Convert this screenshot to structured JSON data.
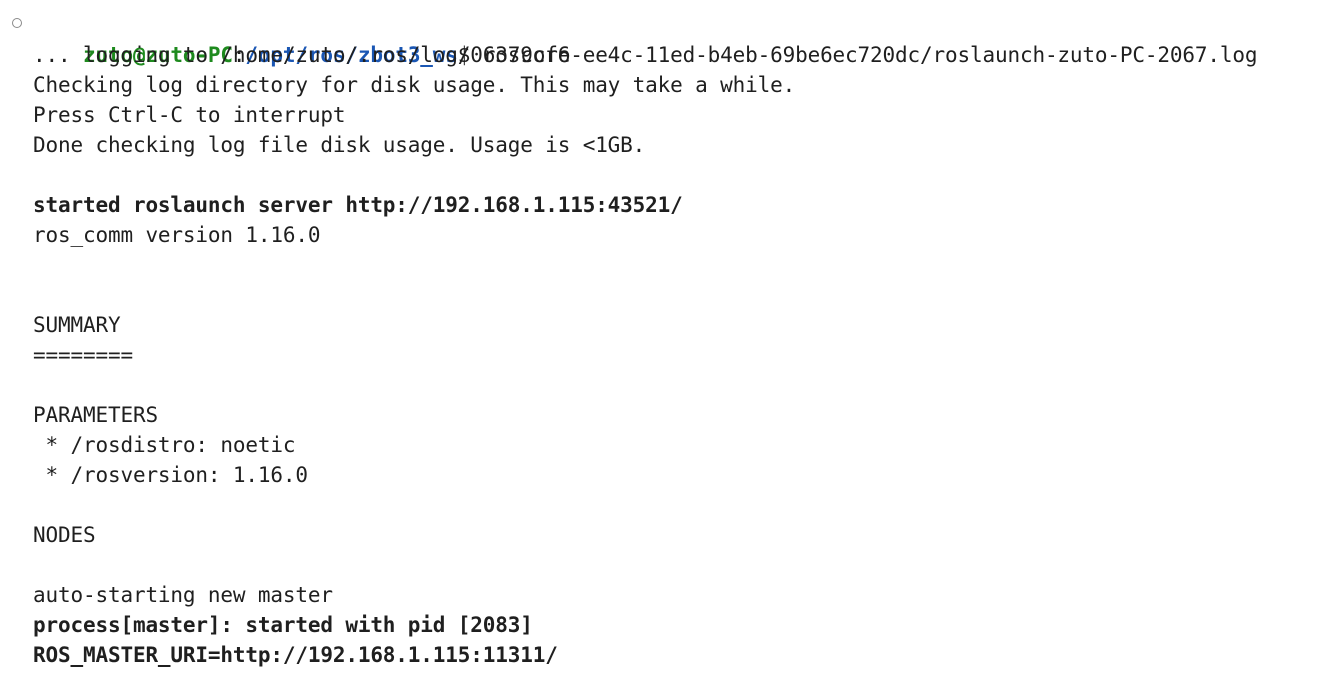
{
  "prompt": {
    "user_host": "zuto@zuto-PC",
    "sep": ":",
    "path": "/opt/ros/zbot3_ws",
    "symbol": "$ ",
    "command": "roscore"
  },
  "output": {
    "l1": "... logging to /home/zuto/.ros/log/06379cf6-ee4c-11ed-b4eb-69be6ec720dc/roslaunch-zuto-PC-2067.log",
    "l2": "Checking log directory for disk usage. This may take a while.",
    "l3": "Press Ctrl-C to interrupt",
    "l4": "Done checking log file disk usage. Usage is <1GB.",
    "l5": "started roslaunch server http://192.168.1.115:43521/",
    "l6": "ros_comm version 1.16.0",
    "l7": "SUMMARY",
    "l8": "========",
    "l9": "PARAMETERS",
    "l10": " * /rosdistro: noetic",
    "l11": " * /rosversion: 1.16.0",
    "l12": "NODES",
    "l13": "auto-starting new master",
    "l14": "process[master]: started with pid [2083]",
    "l15": "ROS_MASTER_URI=http://192.168.1.115:11311/"
  },
  "icons": {
    "command_status": "circle-outline-icon"
  },
  "colors": {
    "user_host": "#1e8a1e",
    "path": "#1a56b3",
    "text": "#1f1f1f",
    "background": "#ffffff"
  }
}
